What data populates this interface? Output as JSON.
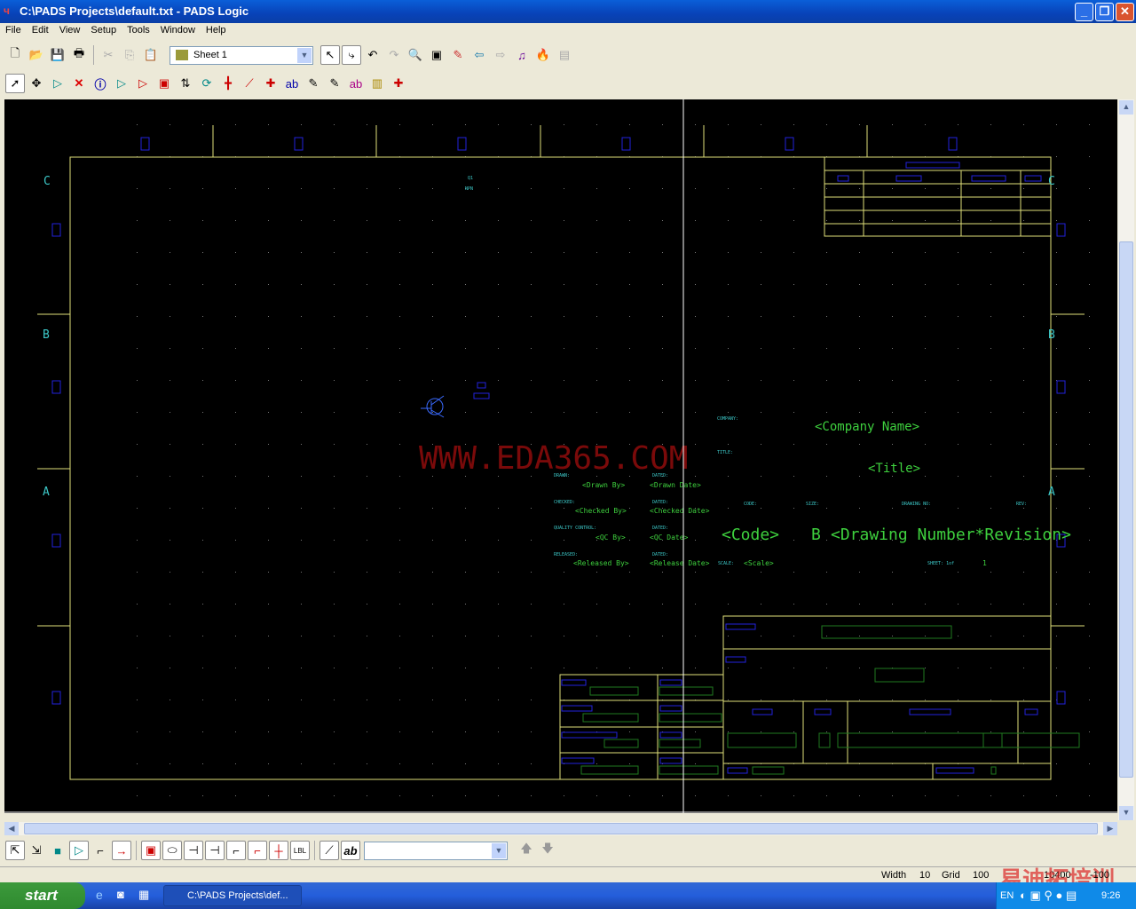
{
  "window": {
    "title": "C:\\PADS Projects\\default.txt - PADS Logic",
    "app_icon": "pads-logic-icon"
  },
  "menu": [
    "File",
    "Edit",
    "View",
    "Setup",
    "Tools",
    "Window",
    "Help"
  ],
  "toolbar": {
    "sheet_select": "Sheet 1"
  },
  "schematic": {
    "zone_rows": [
      "C",
      "B",
      "A"
    ],
    "watermark": "WWW.EDA365.COM",
    "part_ref": "Q1",
    "part_value": "NPN",
    "title_block": {
      "company_label": "COMPANY:",
      "company": "<Company Name>",
      "title_label": "TITLE:",
      "title": "<Title>",
      "drawn_label": "DRAWN:",
      "drawn_by": "<Drawn By>",
      "dated_label": "DATED:",
      "drawn_date": "<Drawn Date>",
      "checked_label": "CHECKED:",
      "checked_by": "<Checked By>",
      "checked_date": "<Checked Date>",
      "qc_label": "QUALITY CONTROL:",
      "qc_by": "<QC By>",
      "qc_date": "<QC Date>",
      "released_label": "RELEASED:",
      "released_by": "<Released By>",
      "release_date": "<Release Date>",
      "code_label": "CODE:",
      "size_label": "SIZE:",
      "drawing_no_label": "DRAWING NO:",
      "rev_label": "REV:",
      "code": "<Code>",
      "size": "B",
      "drawing_number": "<Drawing Number*Revision>",
      "scale_label": "SCALE:",
      "scale": "<Scale>",
      "sheet_label": "SHEET: 1of",
      "sheet_total": "1"
    }
  },
  "bottom_toolbar": {
    "combo_value": ""
  },
  "status": {
    "width_label": "Width",
    "width": "10",
    "grid_label": "Grid",
    "grid": "100",
    "x": "10400",
    "y": "-100"
  },
  "taskbar": {
    "start": "start",
    "task": "C:\\PADS Projects\\def...",
    "time": "9:26",
    "lang": "EN"
  },
  "overlay_watermark": "易迪拓培训"
}
